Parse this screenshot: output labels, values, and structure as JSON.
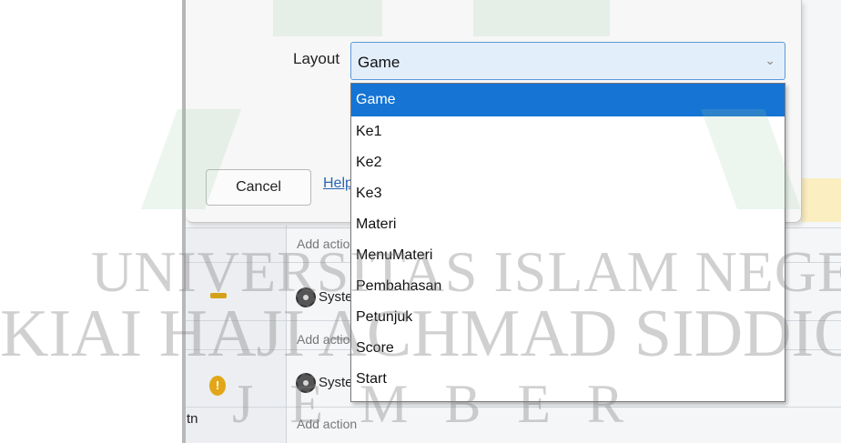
{
  "dialog": {
    "layout_label": "Layout",
    "layout_value": "Game",
    "cancel_label": "Cancel",
    "help_label": "Help"
  },
  "dropdown": {
    "options": [
      "Game",
      "Ke1",
      "Ke2",
      "Ke3",
      "Materi",
      "MenuMateri",
      "Pembahasan",
      "Petunjuk",
      "Score",
      "Start"
    ],
    "selected": "Game"
  },
  "background": {
    "add_action_1": "Add action",
    "add_action_2": "Add action",
    "add_action_3": "Add action",
    "system_1": "System",
    "system_2": "System",
    "left_text": "tn"
  },
  "watermark": {
    "line1": "UNIVERSITAS ISLAM NEGERI",
    "line2": "KIAI HAJI ACHMAD SIDDIQ",
    "line3": "JEMBER"
  },
  "colors": {
    "selection": "#1574d4",
    "select_bg": "#e3eefb",
    "link": "#2a66b3",
    "watermark_green": "#96c8a0"
  }
}
